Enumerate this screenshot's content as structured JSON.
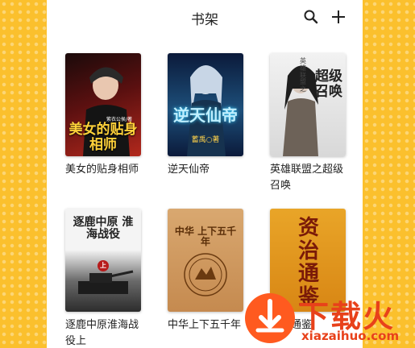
{
  "header": {
    "title": "书架",
    "search_icon": "search-icon",
    "add_icon": "plus-icon"
  },
  "books": [
    {
      "title": "美女的贴身相师",
      "cover_text": "美女的贴身相师",
      "cover_sub": "紫衣公侯/著"
    },
    {
      "title": "逆天仙帝",
      "cover_text": "逆天仙帝",
      "cover_sub": "蓄禹○著"
    },
    {
      "title": "英雄联盟之超级召唤",
      "cover_text": "超级召唤",
      "cover_sub": "英雄联盟之"
    },
    {
      "title": "逐鹿中原淮海战役上",
      "cover_text": "逐鹿中原 淮海战役",
      "cover_sub": "上"
    },
    {
      "title": "中华上下五千年",
      "cover_text": "中华 上下五千年",
      "cover_sub": ""
    },
    {
      "title": "资治通鉴",
      "cover_text": "资治通鉴",
      "cover_sub": ""
    }
  ],
  "watermark": {
    "main": "下载火",
    "sub": "xiazaihuo.com"
  },
  "colors": {
    "background": "#fbc02d",
    "watermark": "#e8411a"
  }
}
